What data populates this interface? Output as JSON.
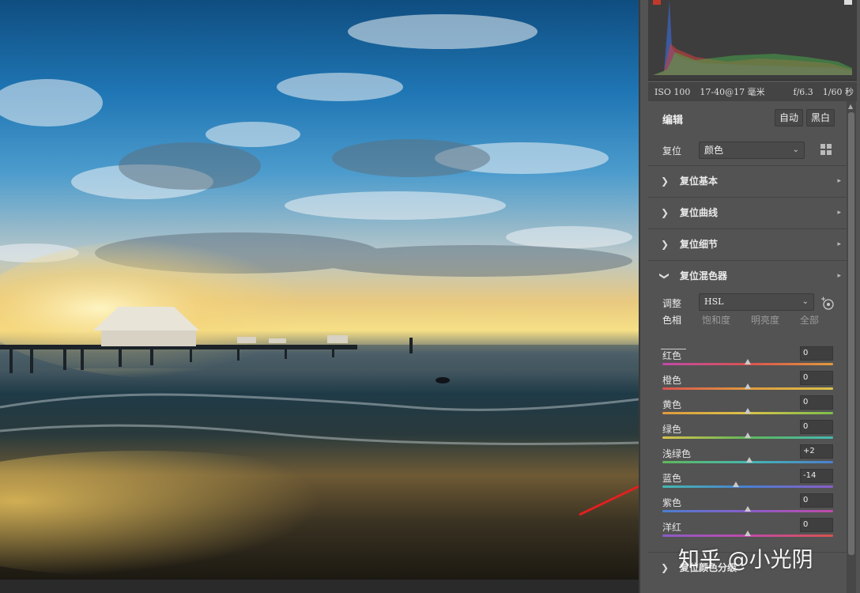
{
  "camera": {
    "iso": "ISO 100",
    "lens": "17-40@17 毫米",
    "aperture": "f/6.3",
    "shutter": "1/60 秒"
  },
  "edit": {
    "title": "编辑",
    "auto": "自动",
    "bw": "黑白"
  },
  "reset": {
    "label": "复位",
    "dropdown": "颜色"
  },
  "sections": [
    {
      "title": "复位基本"
    },
    {
      "title": "复位曲线"
    },
    {
      "title": "复位细节"
    },
    {
      "title": "复位混色器"
    }
  ],
  "mixer": {
    "adjust_label": "调整",
    "adjust_value": "HSL"
  },
  "tabs": [
    "色相",
    "饱和度",
    "明亮度",
    "全部"
  ],
  "sliders": [
    {
      "label": "红色",
      "value": "0"
    },
    {
      "label": "橙色",
      "value": "0"
    },
    {
      "label": "黄色",
      "value": "0"
    },
    {
      "label": "绿色",
      "value": "0"
    },
    {
      "label": "浅绿色",
      "value": "+2"
    },
    {
      "label": "蓝色",
      "value": "-14"
    },
    {
      "label": "紫色",
      "value": "0"
    },
    {
      "label": "洋红",
      "value": "0"
    }
  ],
  "bottom_section": {
    "title": "复位颜色分级"
  },
  "watermark": "知乎 @小光阴",
  "colors": {
    "panel_bg": "#535353",
    "arrow": "#e02020"
  }
}
